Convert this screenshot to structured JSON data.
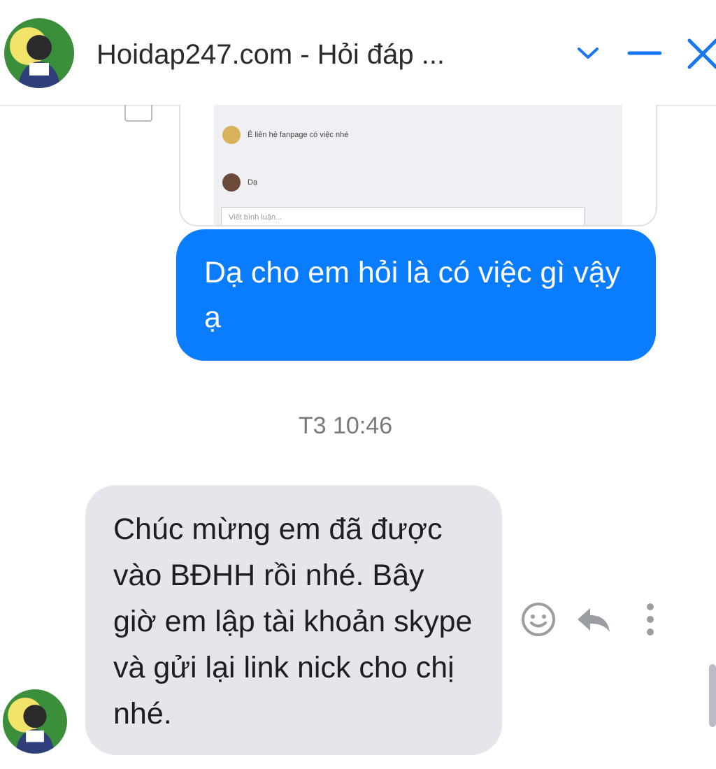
{
  "header": {
    "title": "Hoidap247.com - Hỏi đáp ...",
    "avatar_icon": "user-avatar",
    "chevron_icon": "chevron-down-icon",
    "minimize_icon": "minimize-icon",
    "close_icon": "close-icon",
    "accent_color": "#0a7cff"
  },
  "preview_card": {
    "lines": [
      "Ê liên hệ fanpage có việc nhé",
      "Dạ"
    ],
    "input_placeholder": "Viết bình luận..."
  },
  "messages": {
    "sent_text": "Dạ cho em hỏi là có việc gì vậy ạ",
    "timestamp": "T3 10:46",
    "received_text": "Chúc mừng em đã được vào BĐHH rồi nhé. Bây giờ em lập tài khoản skype và gửi lại link nick cho chị nhé."
  },
  "actions": {
    "react_icon": "smiley-icon",
    "reply_icon": "reply-icon",
    "more_icon": "more-vertical-icon"
  }
}
